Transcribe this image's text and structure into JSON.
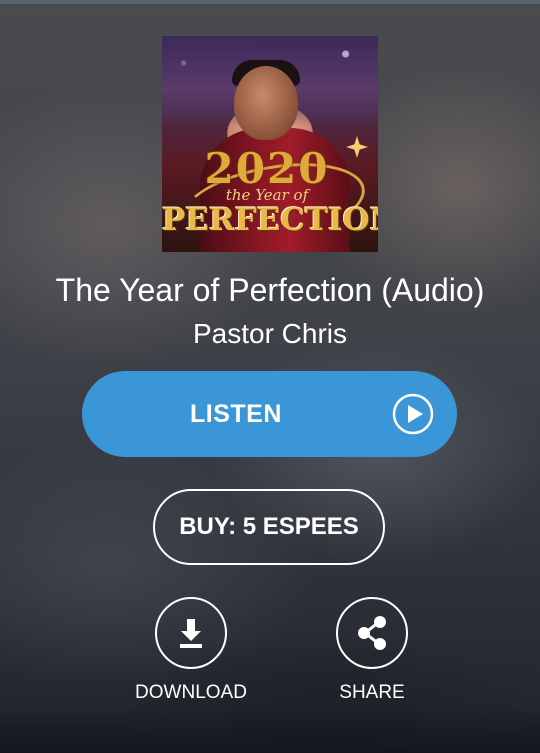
{
  "album": {
    "title": "The Year of Perfection (Audio)",
    "artist": "Pastor Chris",
    "cover": {
      "number": "2020",
      "subtitle": "the Year of",
      "word": "PERFECTION"
    }
  },
  "actions": {
    "listen_label": "LISTEN",
    "buy_label": "BUY: 5 ESPEES",
    "download_label": "DOWNLOAD",
    "share_label": "SHARE"
  },
  "icons": {
    "play": "play-circle-icon",
    "download": "download-icon",
    "share": "share-icon"
  },
  "colors": {
    "accent": "#3a96d6",
    "text": "#ffffff"
  }
}
